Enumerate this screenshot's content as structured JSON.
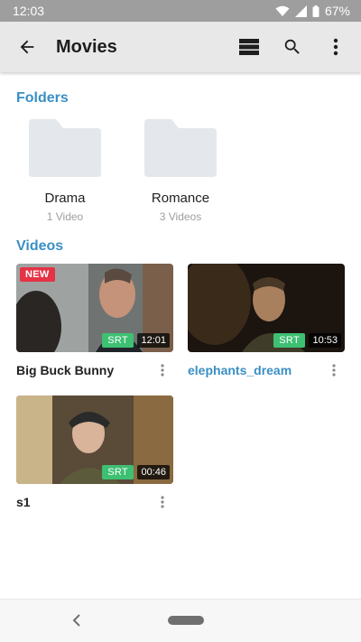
{
  "status_bar": {
    "time": "12:03",
    "battery": "67%"
  },
  "app_bar": {
    "title": "Movies",
    "icons": [
      "back-arrow-icon",
      "view-toggle-icon",
      "search-icon",
      "more-vert-icon"
    ]
  },
  "folders_section": {
    "title": "Folders",
    "items": [
      {
        "name": "Drama",
        "count": "1 Video"
      },
      {
        "name": "Romance",
        "count": "3 Videos"
      }
    ]
  },
  "videos_section": {
    "title": "Videos",
    "items": [
      {
        "title": "Big Buck Bunny",
        "badge": "NEW",
        "subtitle_tag": "SRT",
        "duration": "12:01",
        "highlighted": false
      },
      {
        "title": "elephants_dream",
        "badge": "",
        "subtitle_tag": "SRT",
        "duration": "10:53",
        "highlighted": true
      },
      {
        "title": "s1",
        "badge": "",
        "subtitle_tag": "SRT",
        "duration": "00:46",
        "highlighted": false
      }
    ]
  },
  "colors": {
    "accent": "#3a8fc4",
    "new_badge": "#e53345",
    "srt_badge": "#3ec073",
    "app_bar": "#e8e8e8",
    "folder": "#e4e7eb"
  }
}
